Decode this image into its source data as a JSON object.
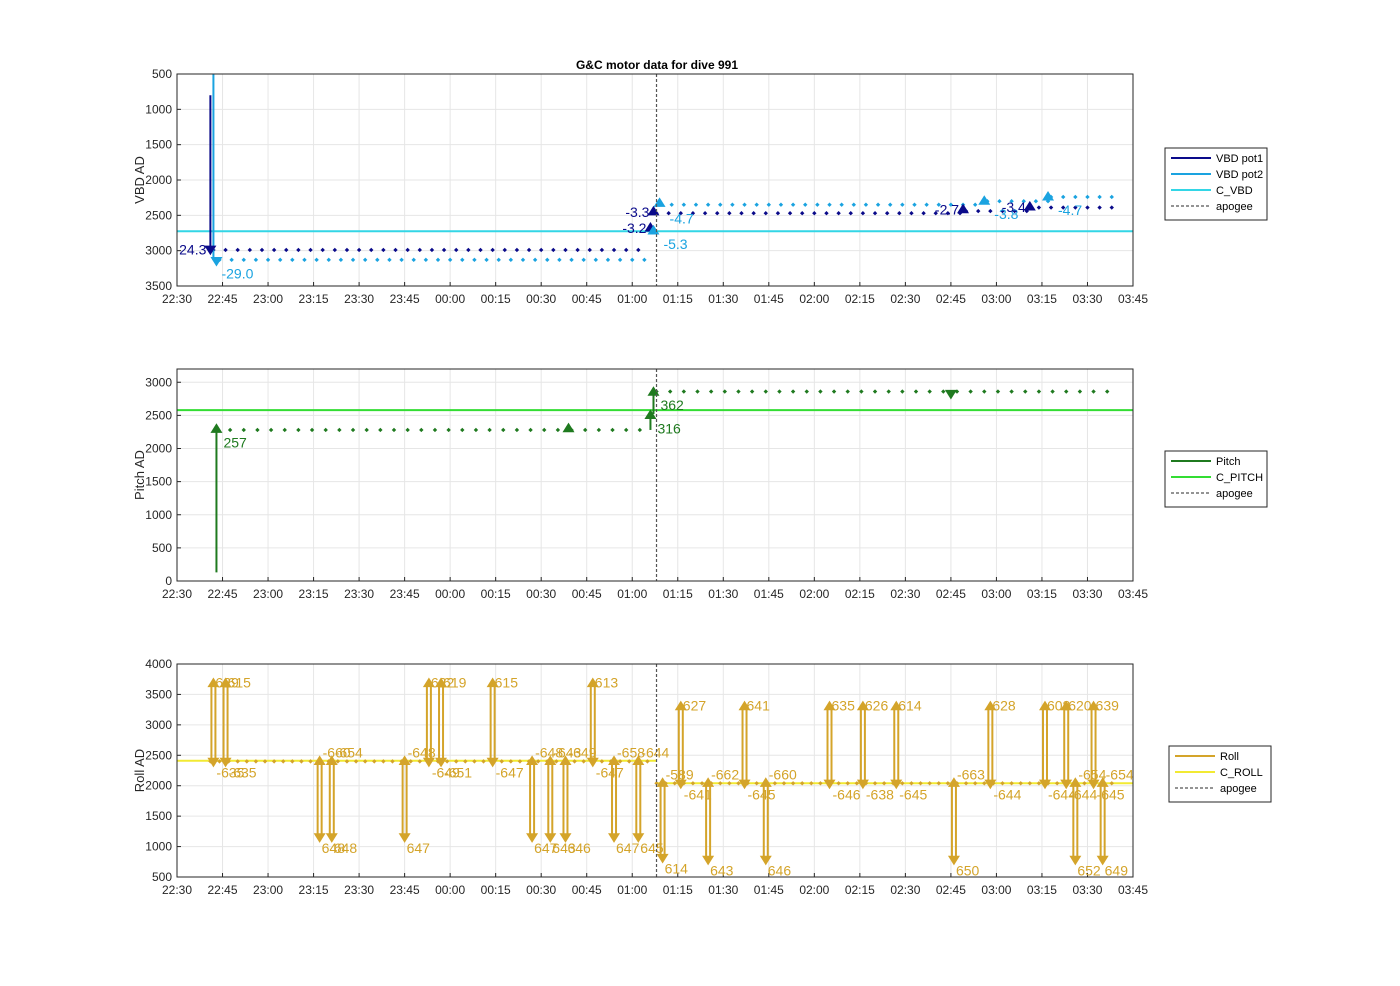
{
  "title": "G&C motor data for dive 991",
  "colors": {
    "vbd_pot1": "#0a0a8a",
    "vbd_pot2": "#1aa3e0",
    "c_vbd": "#33d6e6",
    "pitch": "#1f7a1f",
    "c_pitch": "#33dd33",
    "roll": "#d4a42a",
    "c_roll": "#f2ea33",
    "apogee": "#555555",
    "grid": "#e6e6e6"
  },
  "x_ticks": [
    "22:30",
    "22:45",
    "23:00",
    "23:15",
    "23:30",
    "23:45",
    "00:00",
    "00:15",
    "00:30",
    "00:45",
    "01:00",
    "01:15",
    "01:30",
    "01:45",
    "02:00",
    "02:15",
    "02:30",
    "02:45",
    "03:00",
    "03:15",
    "03:30",
    "03:45"
  ],
  "chart_data": [
    {
      "type": "line",
      "title": "G&C motor data for dive 991",
      "ylabel": "VBD AD",
      "ylim": [
        500,
        3500
      ],
      "y_reversed": true,
      "yticks": [
        500,
        1000,
        1500,
        2000,
        2500,
        3000,
        3500
      ],
      "xlim": [
        "22:30",
        "03:45"
      ],
      "grid": true,
      "legend": [
        "VBD pot1",
        "VBD pot2",
        "C_VBD",
        "apogee"
      ],
      "legend_placement": "outside-right",
      "apogee": "01:08",
      "reference_lines": [
        {
          "name": "C_VBD",
          "y": 2725
        }
      ],
      "series": [
        {
          "name": "VBD pot1",
          "start": "22:41",
          "end": "03:38",
          "levels": [
            {
              "from": "22:42",
              "to": "01:05",
              "y": 2990
            },
            {
              "from": "01:08",
              "to": "02:48",
              "y": 2470
            },
            {
              "from": "02:50",
              "to": "03:12",
              "y": 2440
            },
            {
              "from": "03:14",
              "to": "03:38",
              "y": 2390
            }
          ],
          "jumps": [
            {
              "x": "22:41",
              "from": 800,
              "to": 2980
            }
          ]
        },
        {
          "name": "VBD pot2",
          "start": "22:42",
          "end": "03:38",
          "levels": [
            {
              "from": "22:44",
              "to": "01:05",
              "y": 3130
            },
            {
              "from": "01:09",
              "to": "02:55",
              "y": 2350
            },
            {
              "from": "02:57",
              "to": "03:18",
              "y": 2300
            },
            {
              "from": "03:18",
              "to": "03:38",
              "y": 2240
            }
          ],
          "jumps": [
            {
              "x": "22:42",
              "from": 500,
              "to": 3130
            }
          ]
        }
      ],
      "events": [
        {
          "x": "22:41",
          "y": 2980,
          "dir": "down",
          "series": "VBD pot1",
          "label": "24.3",
          "side": "left"
        },
        {
          "x": "22:43",
          "y": 3140,
          "dir": "down",
          "series": "VBD pot2",
          "label": "-29.0",
          "side": "below"
        },
        {
          "x": "01:07",
          "y": 2450,
          "dir": "up",
          "series": "VBD pot1",
          "label": "-3.3",
          "side": "left"
        },
        {
          "x": "01:09",
          "y": 2330,
          "dir": "up",
          "series": "VBD pot2",
          "label": "-4.7",
          "side": "right"
        },
        {
          "x": "01:06",
          "y": 2680,
          "dir": "up",
          "series": "VBD pot1",
          "label": "-3.2",
          "side": "left"
        },
        {
          "x": "01:07",
          "y": 2720,
          "dir": "up",
          "series": "VBD pot2",
          "label": "-5.3",
          "side": "right-below"
        },
        {
          "x": "02:49",
          "y": 2420,
          "dir": "up",
          "series": "VBD pot1",
          "label": "-2.7",
          "side": "left"
        },
        {
          "x": "02:56",
          "y": 2300,
          "dir": "up",
          "series": "VBD pot2",
          "label": "-3.8",
          "side": "right-below"
        },
        {
          "x": "03:11",
          "y": 2380,
          "dir": "up",
          "series": "VBD pot1",
          "label": "-3.4",
          "side": "left"
        },
        {
          "x": "03:17",
          "y": 2240,
          "dir": "up",
          "series": "VBD pot2",
          "label": "-4.7",
          "side": "right-below"
        }
      ]
    },
    {
      "type": "line",
      "ylabel": "Pitch AD",
      "ylim": [
        0,
        3200
      ],
      "yticks": [
        0,
        500,
        1000,
        1500,
        2000,
        2500,
        3000
      ],
      "xlim": [
        "22:30",
        "03:45"
      ],
      "grid": true,
      "legend": [
        "Pitch",
        "C_PITCH",
        "apogee"
      ],
      "legend_placement": "outside-right",
      "apogee": "01:08",
      "reference_lines": [
        {
          "name": "C_PITCH",
          "y": 2580
        }
      ],
      "series": [
        {
          "name": "Pitch",
          "start": "22:43",
          "end": "03:37",
          "levels": [
            {
              "from": "22:43",
              "to": "01:05",
              "y": 2280
            },
            {
              "from": "01:08",
              "to": "03:37",
              "y": 2860
            }
          ],
          "jumps": [
            {
              "x": "22:43",
              "from": 130,
              "to": 2290
            },
            {
              "x": "01:06",
              "from": 2280,
              "to": 2520
            },
            {
              "x": "01:07",
              "from": 2520,
              "to": 2860
            }
          ]
        }
      ],
      "events": [
        {
          "x": "22:43",
          "y": 2290,
          "dir": "up",
          "label": "257"
        },
        {
          "x": "00:39",
          "y": 2300,
          "dir": "up",
          "label": ""
        },
        {
          "x": "01:06",
          "y": 2500,
          "dir": "up",
          "label": "316"
        },
        {
          "x": "01:07",
          "y": 2850,
          "dir": "up",
          "label": "362"
        },
        {
          "x": "02:45",
          "y": 2830,
          "dir": "down",
          "label": ""
        }
      ]
    },
    {
      "type": "line",
      "ylabel": "Roll AD",
      "ylim": [
        500,
        4000
      ],
      "yticks": [
        500,
        1000,
        1500,
        2000,
        2500,
        3000,
        3500,
        4000
      ],
      "xlim": [
        "22:30",
        "03:45"
      ],
      "grid": true,
      "legend": [
        "Roll",
        "C_ROLL",
        "apogee"
      ],
      "legend_placement": "outside-right",
      "apogee": "01:08",
      "reference_lines": [
        {
          "name": "C_ROLL",
          "from": "22:30",
          "to": "01:08",
          "y": 2410
        },
        {
          "name": "C_ROLL",
          "from": "01:08",
          "to": "03:45",
          "y": 2040
        }
      ],
      "series": [
        {
          "name": "Roll",
          "start": "22:41",
          "end": "03:38",
          "levels": [
            {
              "from": "22:41",
              "to": "01:05",
              "y": 2400
            },
            {
              "from": "01:08",
              "to": "03:38",
              "y": 2040
            }
          ]
        }
      ],
      "events": [
        {
          "x": "22:42",
          "y1": 2400,
          "y2": 3680,
          "label": "629",
          "back": "-635"
        },
        {
          "x": "22:46",
          "y1": 2400,
          "y2": 3680,
          "label": "615",
          "back": "-635"
        },
        {
          "x": "23:17",
          "y1": 2400,
          "y2": 1160,
          "label": "648",
          "back": "-660"
        },
        {
          "x": "23:21",
          "y1": 2400,
          "y2": 1160,
          "label": "648",
          "back": "-654"
        },
        {
          "x": "23:45",
          "y1": 2400,
          "y2": 1160,
          "label": "647",
          "back": "-648"
        },
        {
          "x": "23:53",
          "y1": 2400,
          "y2": 3680,
          "label": "622",
          "back": "-649"
        },
        {
          "x": "23:57",
          "y1": 2400,
          "y2": 3680,
          "label": "619",
          "back": "-651"
        },
        {
          "x": "00:14",
          "y1": 2400,
          "y2": 3680,
          "label": "615",
          "back": "-647"
        },
        {
          "x": "00:27",
          "y1": 2400,
          "y2": 1160,
          "label": "647",
          "back": "-648"
        },
        {
          "x": "00:33",
          "y1": 2400,
          "y2": 1160,
          "label": "643",
          "back": "-643"
        },
        {
          "x": "00:38",
          "y1": 2400,
          "y2": 1160,
          "label": "646",
          "back": "-649"
        },
        {
          "x": "00:47",
          "y1": 2400,
          "y2": 3680,
          "label": "613",
          "back": "-647"
        },
        {
          "x": "00:54",
          "y1": 2400,
          "y2": 1160,
          "label": "647",
          "back": "-658"
        },
        {
          "x": "01:02",
          "y1": 2400,
          "y2": 1160,
          "label": "645",
          "back": "-644"
        },
        {
          "x": "01:10",
          "y1": 2040,
          "y2": 820,
          "label": "614",
          "back": "-589"
        },
        {
          "x": "01:16",
          "y1": 2040,
          "y2": 3300,
          "label": "627",
          "back": "-641"
        },
        {
          "x": "01:25",
          "y1": 2040,
          "y2": 790,
          "label": "643",
          "back": "-662"
        },
        {
          "x": "01:37",
          "y1": 2040,
          "y2": 3300,
          "label": "641",
          "back": "-645"
        },
        {
          "x": "01:44",
          "y1": 2040,
          "y2": 790,
          "label": "646",
          "back": "-660"
        },
        {
          "x": "02:05",
          "y1": 2040,
          "y2": 3300,
          "label": "635",
          "back": "-646"
        },
        {
          "x": "02:16",
          "y1": 2040,
          "y2": 3300,
          "label": "626",
          "back": "-638"
        },
        {
          "x": "02:27",
          "y1": 2040,
          "y2": 3300,
          "label": "614",
          "back": "-645"
        },
        {
          "x": "02:46",
          "y1": 2040,
          "y2": 790,
          "label": "650",
          "back": "-663"
        },
        {
          "x": "02:58",
          "y1": 2040,
          "y2": 3300,
          "label": "628",
          "back": "-644"
        },
        {
          "x": "03:16",
          "y1": 2040,
          "y2": 3300,
          "label": "608",
          "back": "-644"
        },
        {
          "x": "03:23",
          "y1": 2040,
          "y2": 3300,
          "label": "620",
          "back": "-644"
        },
        {
          "x": "03:26",
          "y1": 2040,
          "y2": 790,
          "label": "652",
          "back": "-654"
        },
        {
          "x": "03:32",
          "y1": 2040,
          "y2": 3300,
          "label": "639",
          "back": "-645"
        },
        {
          "x": "03:35",
          "y1": 2040,
          "y2": 790,
          "label": "649",
          "back": "-654"
        }
      ]
    }
  ]
}
